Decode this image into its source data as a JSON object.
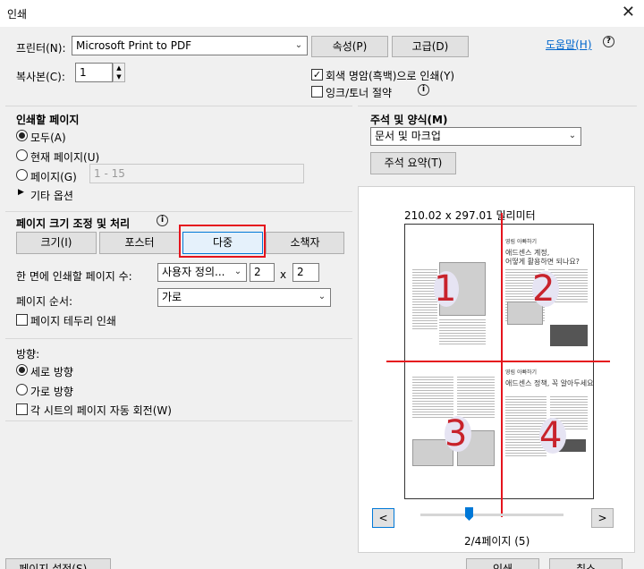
{
  "window": {
    "title": "인쇄",
    "close_glyph": "✕"
  },
  "printer": {
    "label": "프린터(N):",
    "selected": "Microsoft Print to PDF",
    "properties_button": "속성(P)",
    "advanced_button": "고급(D)",
    "help_link": "도움말(H)",
    "help_icon": "?"
  },
  "copies": {
    "label": "복사본(C):",
    "value": "1"
  },
  "options": {
    "grayscale_label": "회색 명암(흑백)으로 인쇄(Y)",
    "grayscale_checked": true,
    "save_ink_label": "잉크/토너 절약",
    "save_ink_checked": false
  },
  "pages_to_print": {
    "heading": "인쇄할 페이지",
    "all": "모두(A)",
    "current": "현재 페이지(U)",
    "pages": "페이지(G)",
    "pages_placeholder": "1 - 15",
    "more_options": "기타 옵션",
    "selected": "all"
  },
  "comments": {
    "heading": "주석 및 양식(M)",
    "selected": "문서 및 마크업",
    "summarize_button": "주석 요약(T)"
  },
  "page_sizing": {
    "heading": "페이지 크기 조정 및 처리",
    "tabs": [
      "크기(I)",
      "포스터",
      "다중",
      "소책자"
    ],
    "selected_tab": "다중",
    "pages_per_sheet_label": "한 면에 인쇄할 페이지 수:",
    "pages_per_sheet_value": "사용자 정의...",
    "cols": "2",
    "times": "x",
    "rows": "2",
    "order_label": "페이지 순서:",
    "order_value": "가로",
    "border_label": "페이지 테두리 인쇄",
    "border_checked": false
  },
  "orientation": {
    "heading": "방향:",
    "portrait": "세로 방향",
    "landscape": "가로 방향",
    "auto_rotate": "각 시트의 페이지 자동 회전(W)",
    "selected": "portrait",
    "auto_rotate_checked": false
  },
  "preview": {
    "dimensions": "210.02 x 297.01 밀리미터",
    "page_info": "2/4페이지 (5)",
    "prev": "<",
    "next": ">",
    "slider_fraction": 0.33,
    "overlay_numbers": [
      "1",
      "2",
      "3",
      "4"
    ],
    "mini_title_a": "애드센스 계정,",
    "mini_title_b": "어떻게 활용하면 되나요?",
    "mini_title_c": "애드센스 정책, 꼭 알아두세요!",
    "mini_kicker_a": "영림 아빠하기",
    "mini_kicker_b": "영림 아빠하기"
  },
  "footer": {
    "page_setup": "페이지 설정(S)...",
    "print": "인쇄",
    "cancel": "취소"
  },
  "colors": {
    "accent": "#0078d7",
    "highlight_red": "#e5141d",
    "link": "#0066cc"
  }
}
